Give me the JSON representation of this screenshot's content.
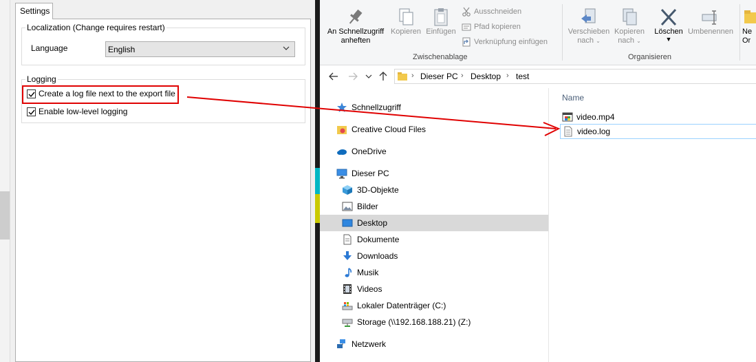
{
  "settings": {
    "tab_label": "Settings",
    "localization": {
      "group_title": "Localization (Change requires restart)",
      "language_label": "Language",
      "language_value": "English"
    },
    "logging": {
      "group_title": "Logging",
      "create_log_label": "Create a log file next to the export file",
      "create_log_checked": true,
      "low_level_label": "Enable low-level logging",
      "low_level_checked": true
    }
  },
  "explorer": {
    "ribbon": {
      "pin_label_1": "An Schnellzugriff",
      "pin_label_2": "anheften",
      "copy_label": "Kopieren",
      "paste_label": "Einfügen",
      "cut_label": "Ausschneiden",
      "copy_path_label": "Pfad kopieren",
      "paste_shortcut_label": "Verknüpfung einfügen",
      "clipboard_group": "Zwischenablage",
      "move_to_label_1": "Verschieben",
      "move_to_label_2": "nach",
      "copy_to_label_1": "Kopieren",
      "copy_to_label_2": "nach",
      "delete_label": "Löschen",
      "rename_label": "Umbenennen",
      "organize_group": "Organisieren",
      "new_folder_label_1": "Ne",
      "new_folder_label_2": "Or"
    },
    "breadcrumb": [
      "Dieser PC",
      "Desktop",
      "test"
    ],
    "nav": {
      "quick_access": "Schnellzugriff",
      "creative_cloud": "Creative Cloud Files",
      "onedrive": "OneDrive",
      "this_pc": "Dieser PC",
      "objects3d": "3D-Objekte",
      "pictures": "Bilder",
      "desktop": "Desktop",
      "documents": "Dokumente",
      "downloads": "Downloads",
      "music": "Musik",
      "videos": "Videos",
      "local_disk": "Lokaler Datenträger (C:)",
      "storage": "Storage (\\\\192.168.188.21) (Z:)",
      "network": "Netzwerk"
    },
    "files": {
      "column_name": "Name",
      "items": [
        "video.mp4",
        "video.log"
      ]
    }
  },
  "colors": {
    "annotation_red": "#e00000",
    "selection_blue": "#99d1ff",
    "nav_selected": "#d9d9d9"
  }
}
